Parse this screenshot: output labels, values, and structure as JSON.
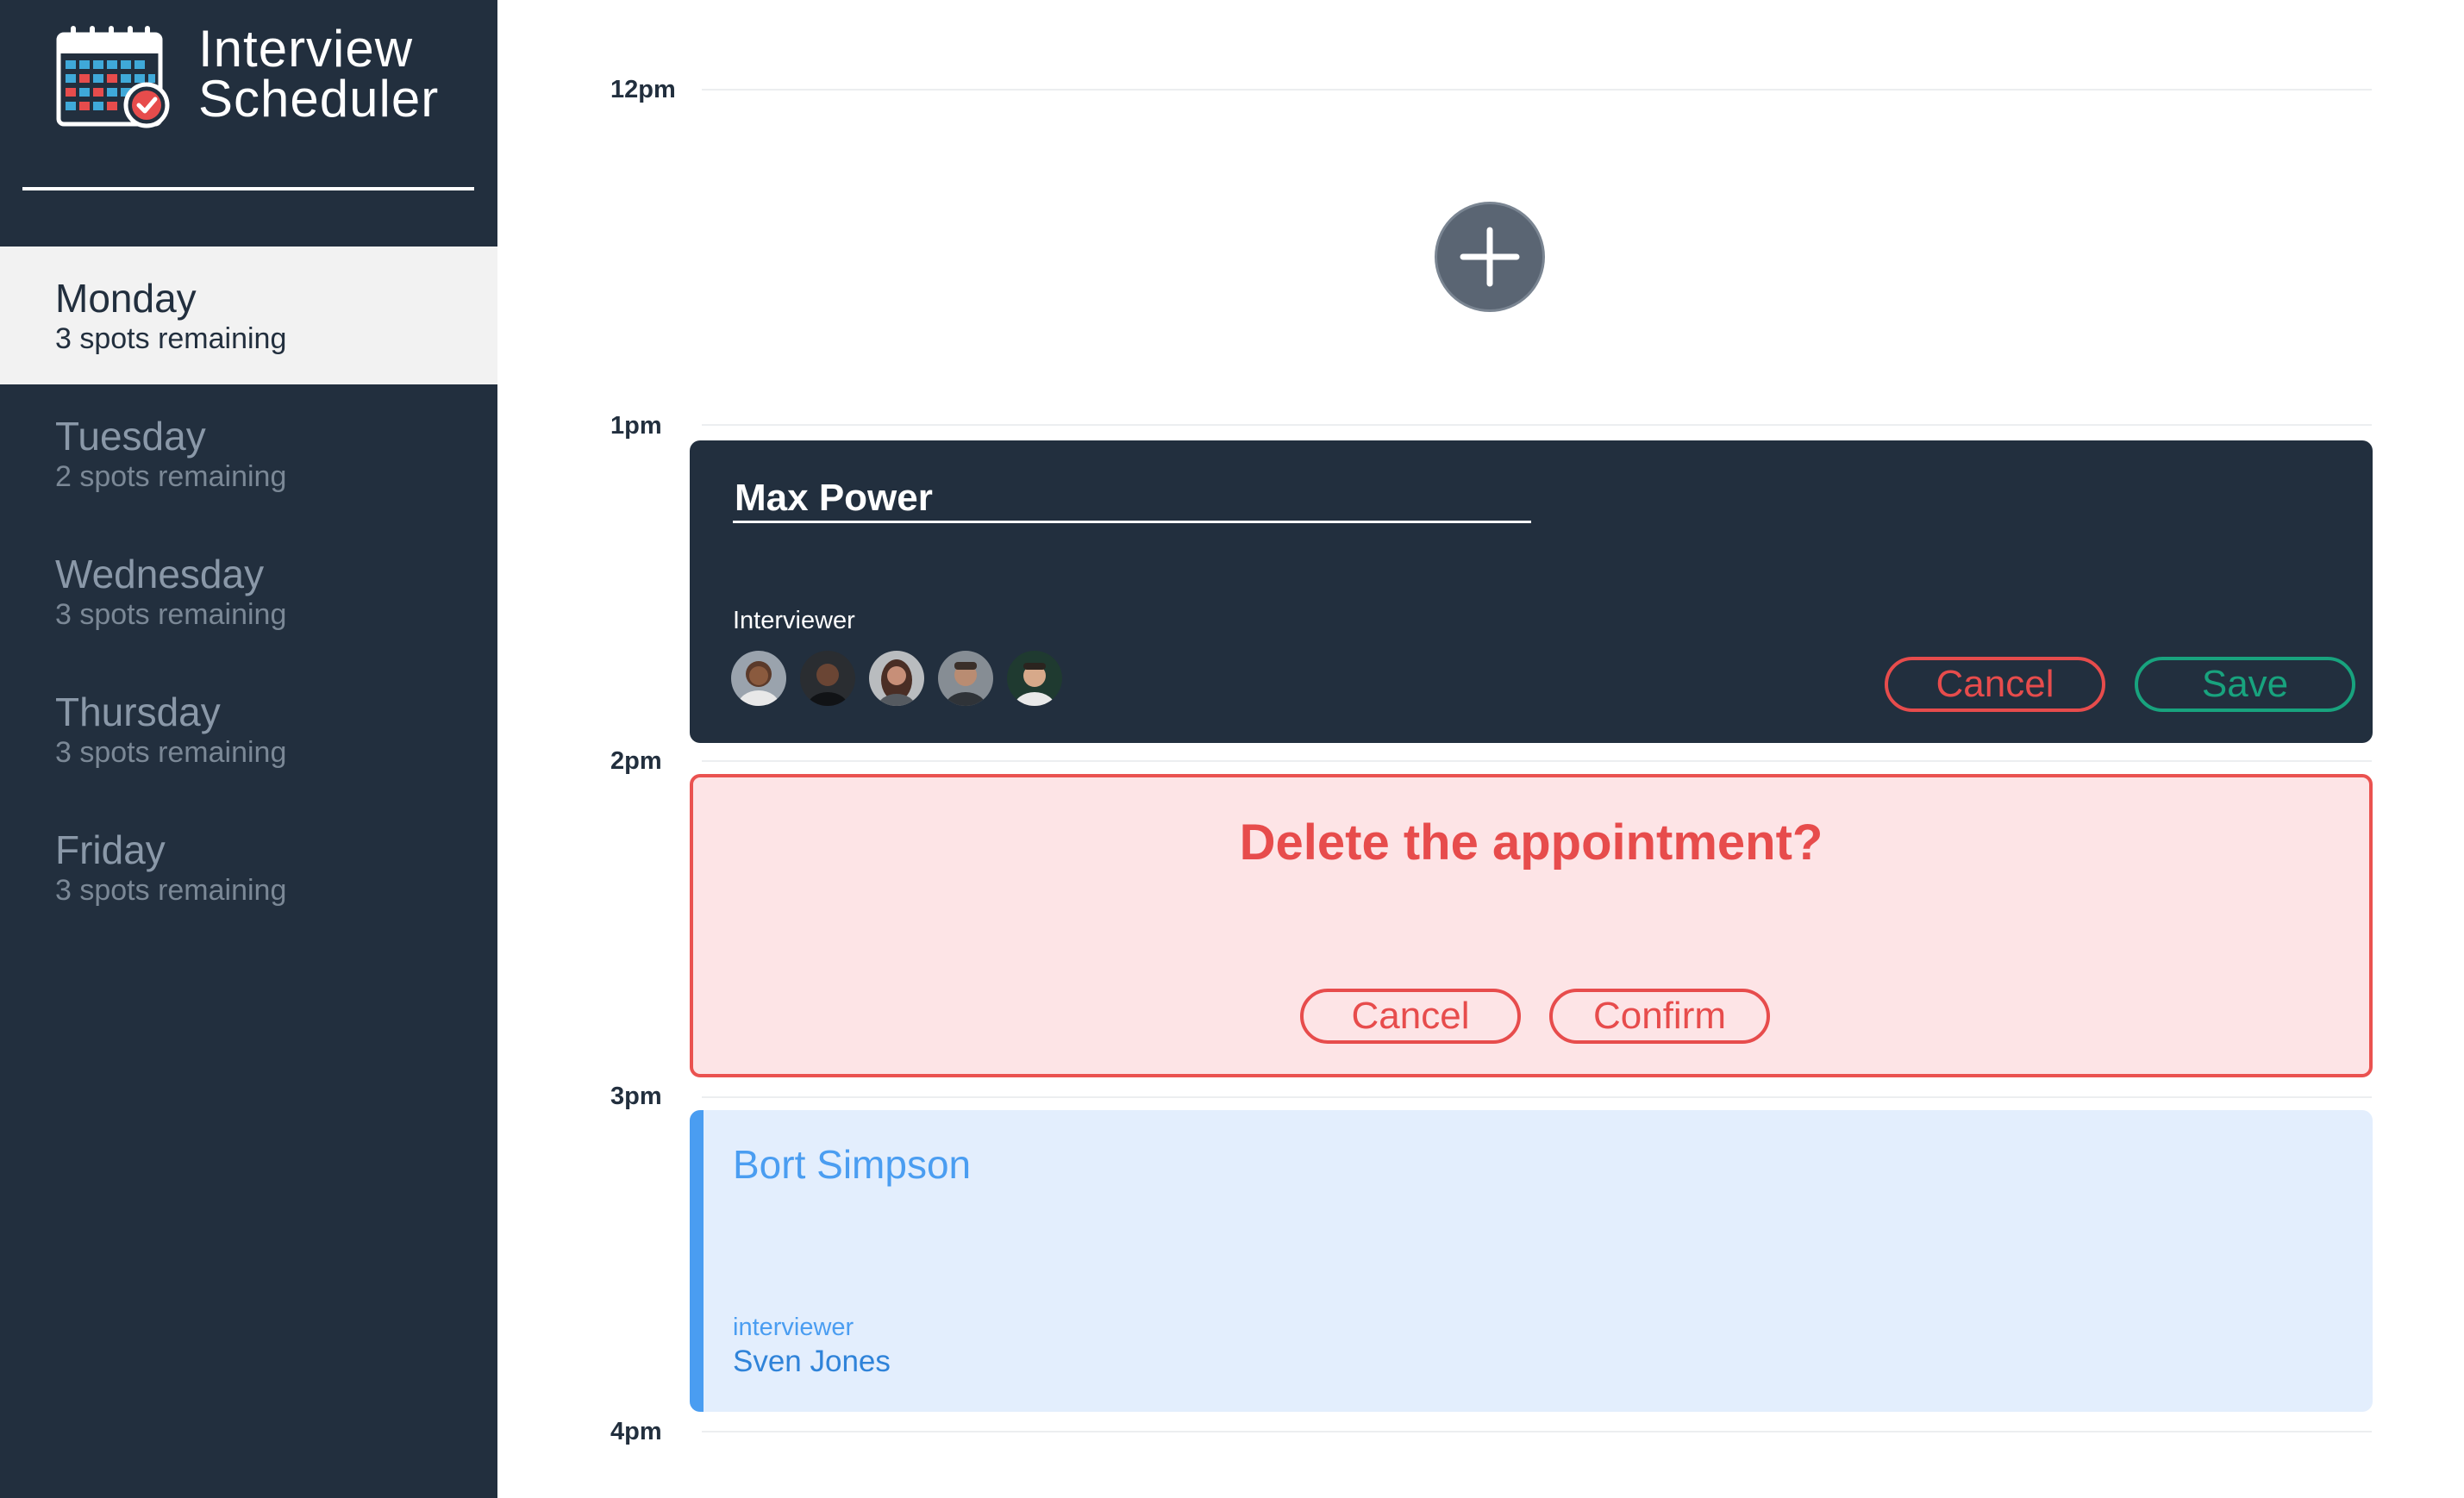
{
  "app": {
    "title_line1": "Interview",
    "title_line2": "Scheduler"
  },
  "sidebar": {
    "days": [
      {
        "name": "Monday",
        "spots": "3 spots remaining",
        "selected": true
      },
      {
        "name": "Tuesday",
        "spots": "2 spots remaining",
        "selected": false
      },
      {
        "name": "Wednesday",
        "spots": "3 spots remaining",
        "selected": false
      },
      {
        "name": "Thursday",
        "spots": "3 spots remaining",
        "selected": false
      },
      {
        "name": "Friday",
        "spots": "3 spots remaining",
        "selected": false
      }
    ]
  },
  "schedule": {
    "times": [
      "12pm",
      "1pm",
      "2pm",
      "3pm",
      "4pm"
    ],
    "add_icon": "plus-icon",
    "form": {
      "name_value": "Max Power",
      "interviewer_label": "Interviewer",
      "avatars": [
        "interviewer-avatar-1",
        "interviewer-avatar-2",
        "interviewer-avatar-3",
        "interviewer-avatar-4",
        "interviewer-avatar-5"
      ],
      "cancel_label": "Cancel",
      "save_label": "Save"
    },
    "delete_confirm": {
      "message": "Delete the appointment?",
      "cancel_label": "Cancel",
      "confirm_label": "Confirm"
    },
    "appointment": {
      "student": "Bort Simpson",
      "interviewer_label": "interviewer",
      "interviewer_name": "Sven Jones"
    }
  },
  "colors": {
    "sidebar_bg": "#222f3e",
    "danger": "#e74c4c",
    "confirm": "#18a37e",
    "accent_blue": "#4a9df1",
    "danger_bg": "#fde4e6",
    "appointment_bg": "#e3eefd"
  }
}
